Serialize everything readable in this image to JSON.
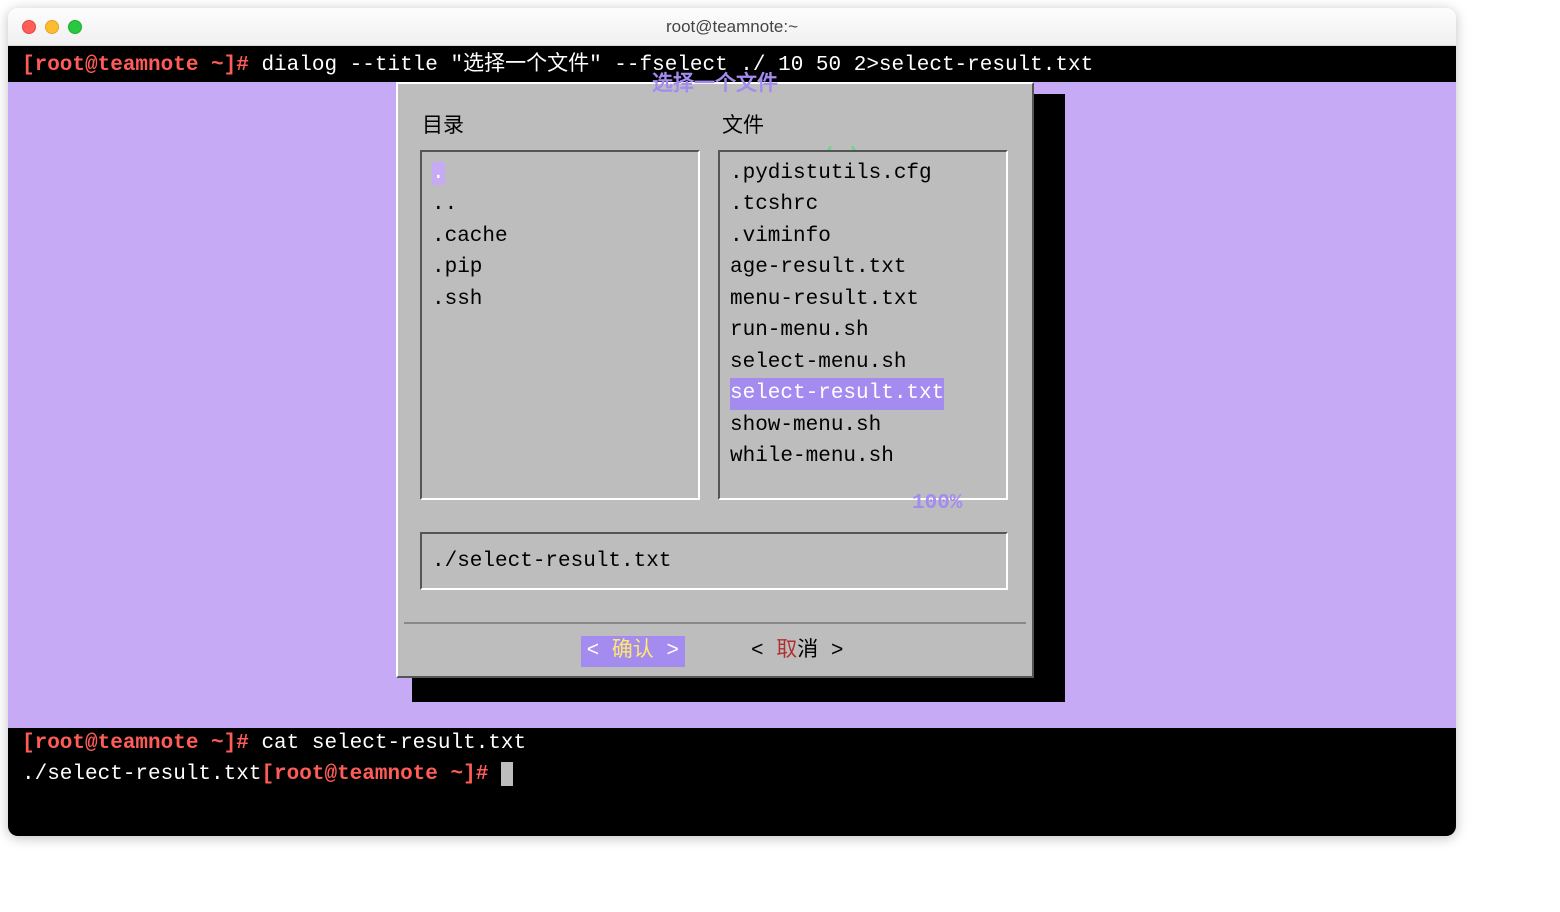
{
  "window_title": "root@teamnote:~",
  "prompt": "[root@teamnote ~]#",
  "command1": "dialog --title \"选择一个文件\" --fselect ./ 10 50 2>select-result.txt",
  "command2": "cat select-result.txt",
  "output2": "./select-result.txt",
  "dialog": {
    "title": "选择一个文件",
    "dir_header": "目录",
    "file_header": "文件",
    "scroll_ind": "↑(-)",
    "percent": "100%",
    "dirs": [
      ".",
      "..",
      ".cache",
      ".pip",
      ".ssh"
    ],
    "dir_selected_index": 0,
    "files": [
      ".pydistutils.cfg",
      ".tcshrc",
      ".viminfo",
      "age-result.txt",
      "menu-result.txt",
      "run-menu.sh",
      "select-menu.sh",
      "select-result.txt",
      "show-menu.sh",
      "while-menu.sh"
    ],
    "file_selected_index": 7,
    "current_path": "./select-result.txt",
    "ok_label": "确认",
    "cancel_label": "取消"
  }
}
